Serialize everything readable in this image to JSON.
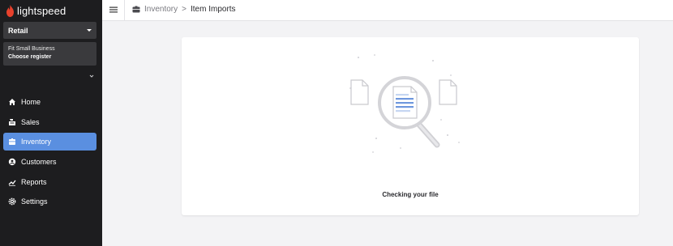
{
  "app": {
    "brand": "lightspeed"
  },
  "sidebar": {
    "outlet_select": "Retail",
    "store": {
      "name": "Fit Small Business",
      "register_label": "Choose register"
    },
    "items": [
      {
        "label": "Home",
        "icon": "home-icon"
      },
      {
        "label": "Sales",
        "icon": "sales-icon"
      },
      {
        "label": "Inventory",
        "icon": "inventory-icon",
        "active": true
      },
      {
        "label": "Customers",
        "icon": "customers-icon"
      },
      {
        "label": "Reports",
        "icon": "reports-icon"
      },
      {
        "label": "Settings",
        "icon": "settings-icon"
      }
    ]
  },
  "header": {
    "breadcrumb": {
      "parent": "Inventory",
      "separator": ">",
      "current": "Item Imports"
    }
  },
  "main": {
    "status": "Checking your file"
  },
  "colors": {
    "sidebar_bg": "#1d1d1f",
    "active": "#5a8fe0",
    "brand_flame": "#e8412c"
  }
}
